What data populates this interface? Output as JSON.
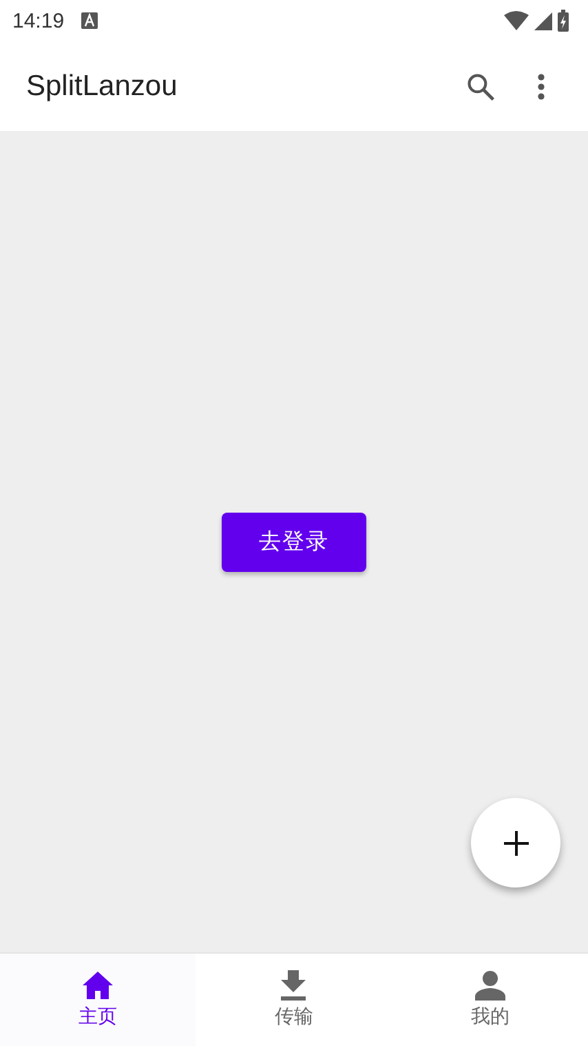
{
  "status_bar": {
    "time": "14:19"
  },
  "app_bar": {
    "title": "SplitLanzou"
  },
  "content": {
    "login_button": "去登录"
  },
  "bottom_nav": [
    {
      "label": "主页",
      "kind": "home",
      "selected": true
    },
    {
      "label": "传输",
      "kind": "download",
      "selected": false
    },
    {
      "label": "我的",
      "kind": "person",
      "selected": false
    }
  ]
}
